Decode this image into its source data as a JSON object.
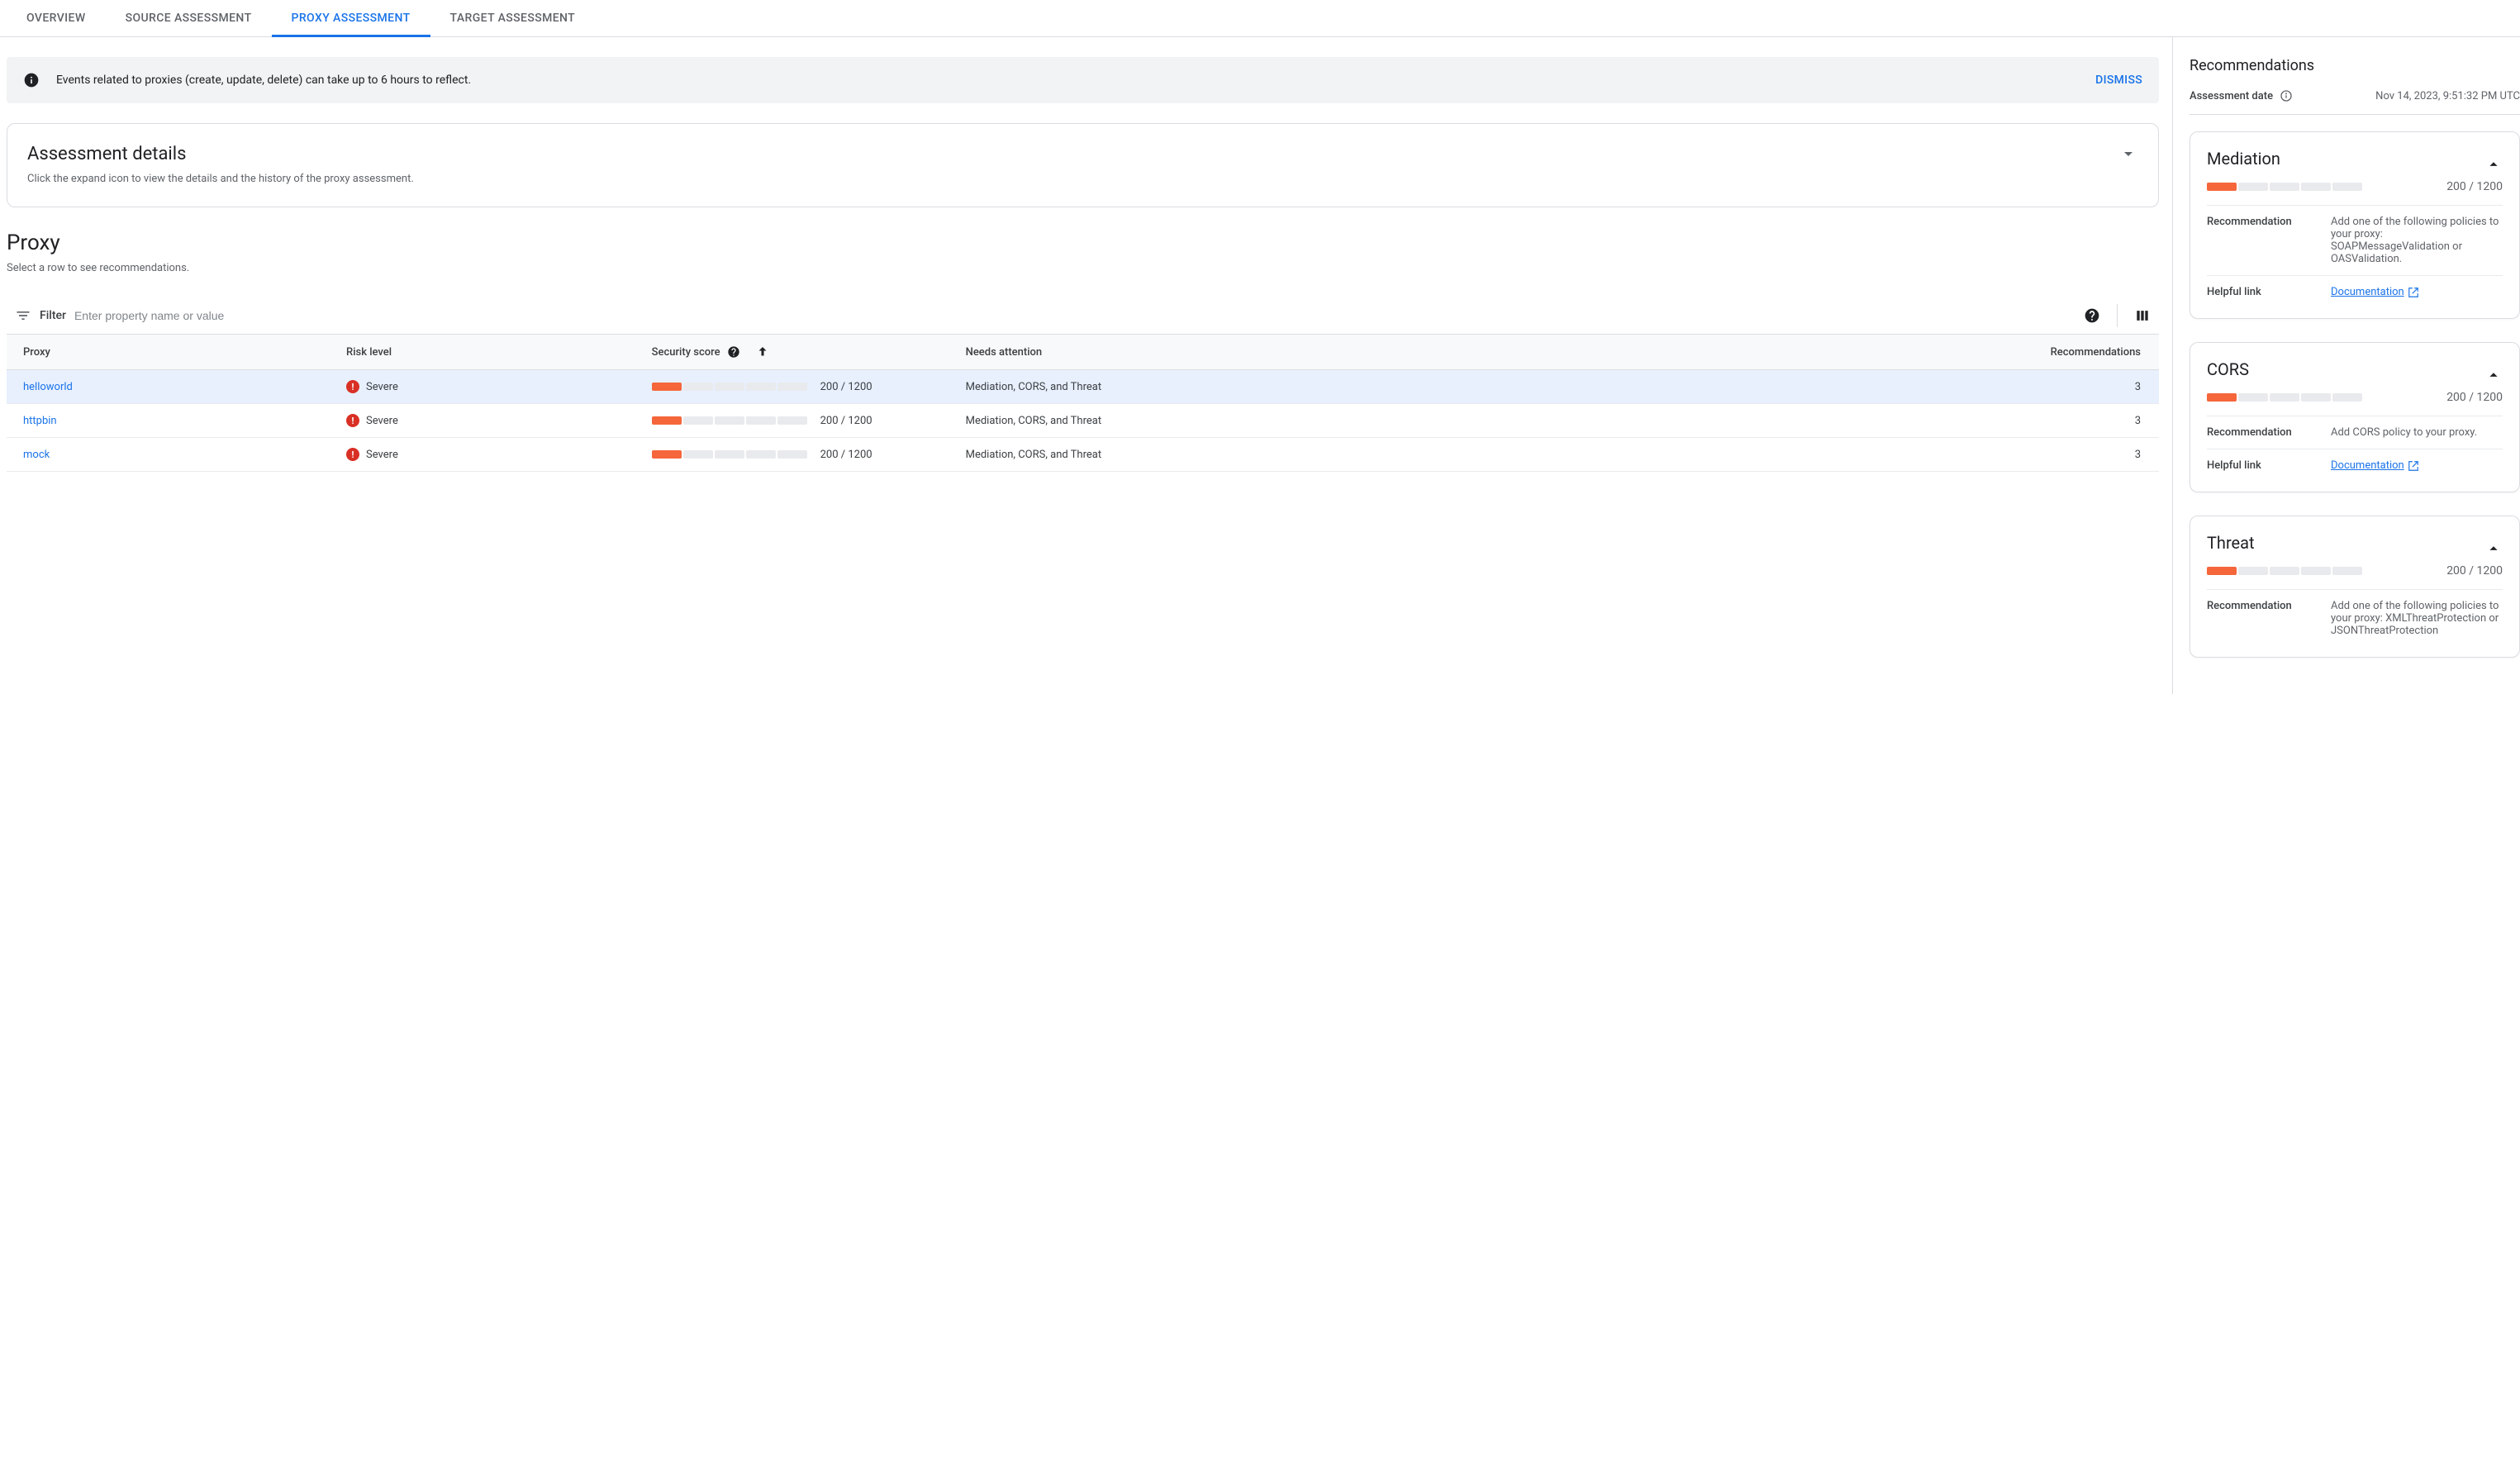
{
  "tabs": [
    {
      "label": "OVERVIEW"
    },
    {
      "label": "SOURCE ASSESSMENT"
    },
    {
      "label": "PROXY ASSESSMENT",
      "active": true
    },
    {
      "label": "TARGET ASSESSMENT"
    }
  ],
  "banner": {
    "message": "Events related to proxies (create, update, delete) can take up to 6 hours to reflect.",
    "dismiss": "DISMISS"
  },
  "details": {
    "title": "Assessment details",
    "subtitle": "Click the expand icon to view the details and the history of the proxy assessment."
  },
  "proxy_section": {
    "title": "Proxy",
    "subtitle": "Select a row to see recommendations."
  },
  "filter": {
    "label": "Filter",
    "placeholder": "Enter property name or value"
  },
  "columns": {
    "proxy": "Proxy",
    "risk": "Risk level",
    "score": "Security score",
    "needs": "Needs attention",
    "recs": "Recommendations"
  },
  "rows": [
    {
      "proxy": "helloworld",
      "risk": "Severe",
      "score": "200 / 1200",
      "needs": "Mediation, CORS, and Threat",
      "recs": "3",
      "selected": true
    },
    {
      "proxy": "httpbin",
      "risk": "Severe",
      "score": "200 / 1200",
      "needs": "Mediation, CORS, and Threat",
      "recs": "3"
    },
    {
      "proxy": "mock",
      "risk": "Severe",
      "score": "200 / 1200",
      "needs": "Mediation, CORS, and Threat",
      "recs": "3"
    }
  ],
  "side": {
    "title": "Recommendations",
    "assessment_label": "Assessment date",
    "assessment_date": "Nov 14, 2023, 9:51:32 PM UTC",
    "cards": [
      {
        "title": "Mediation",
        "score": "200 / 1200",
        "rec_label": "Recommendation",
        "rec_text": "Add one of the following policies to your proxy: SOAPMessageValidation or OASValidation.",
        "link_label": "Helpful link",
        "link_text": "Documentation"
      },
      {
        "title": "CORS",
        "score": "200 / 1200",
        "rec_label": "Recommendation",
        "rec_text": "Add CORS policy to your proxy.",
        "link_label": "Helpful link",
        "link_text": "Documentation"
      },
      {
        "title": "Threat",
        "score": "200 / 1200",
        "rec_label": "Recommendation",
        "rec_text": "Add one of the following policies to your proxy: XMLThreatProtection or JSONThreatProtection",
        "no_link": true
      }
    ]
  }
}
